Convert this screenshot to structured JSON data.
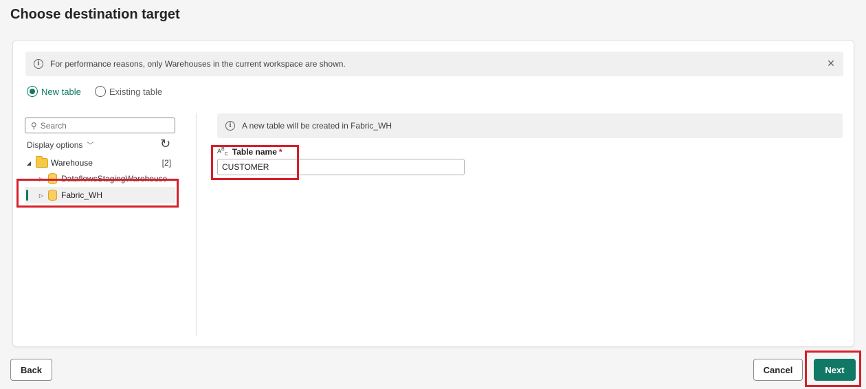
{
  "page": {
    "title": "Choose destination target"
  },
  "banner": {
    "text": "For performance reasons, only Warehouses in the current workspace are shown.",
    "close_glyph": "✕"
  },
  "mode": {
    "options": [
      {
        "label": "New table",
        "checked": true
      },
      {
        "label": "Existing table",
        "checked": false
      }
    ]
  },
  "navigator": {
    "search_placeholder": "Search",
    "display_options_label": "Display options",
    "tree": [
      {
        "label": "Warehouse",
        "count": "[2]",
        "expanded": true,
        "icon": "folder-icon"
      },
      {
        "label": "DataflowsStagingWarehouse",
        "icon": "database-icon"
      },
      {
        "label": "Fabric_WH",
        "icon": "database-icon",
        "selected": true
      }
    ]
  },
  "details": {
    "info_text": "A new table will be created in Fabric_WH",
    "field_label": "Table name",
    "required_marker": "*",
    "table_name_value": "CUSTOMER"
  },
  "footer": {
    "back_label": "Back",
    "cancel_label": "Cancel",
    "next_label": "Next"
  },
  "colors": {
    "accent": "#117865",
    "highlight_box": "#d5202a"
  }
}
